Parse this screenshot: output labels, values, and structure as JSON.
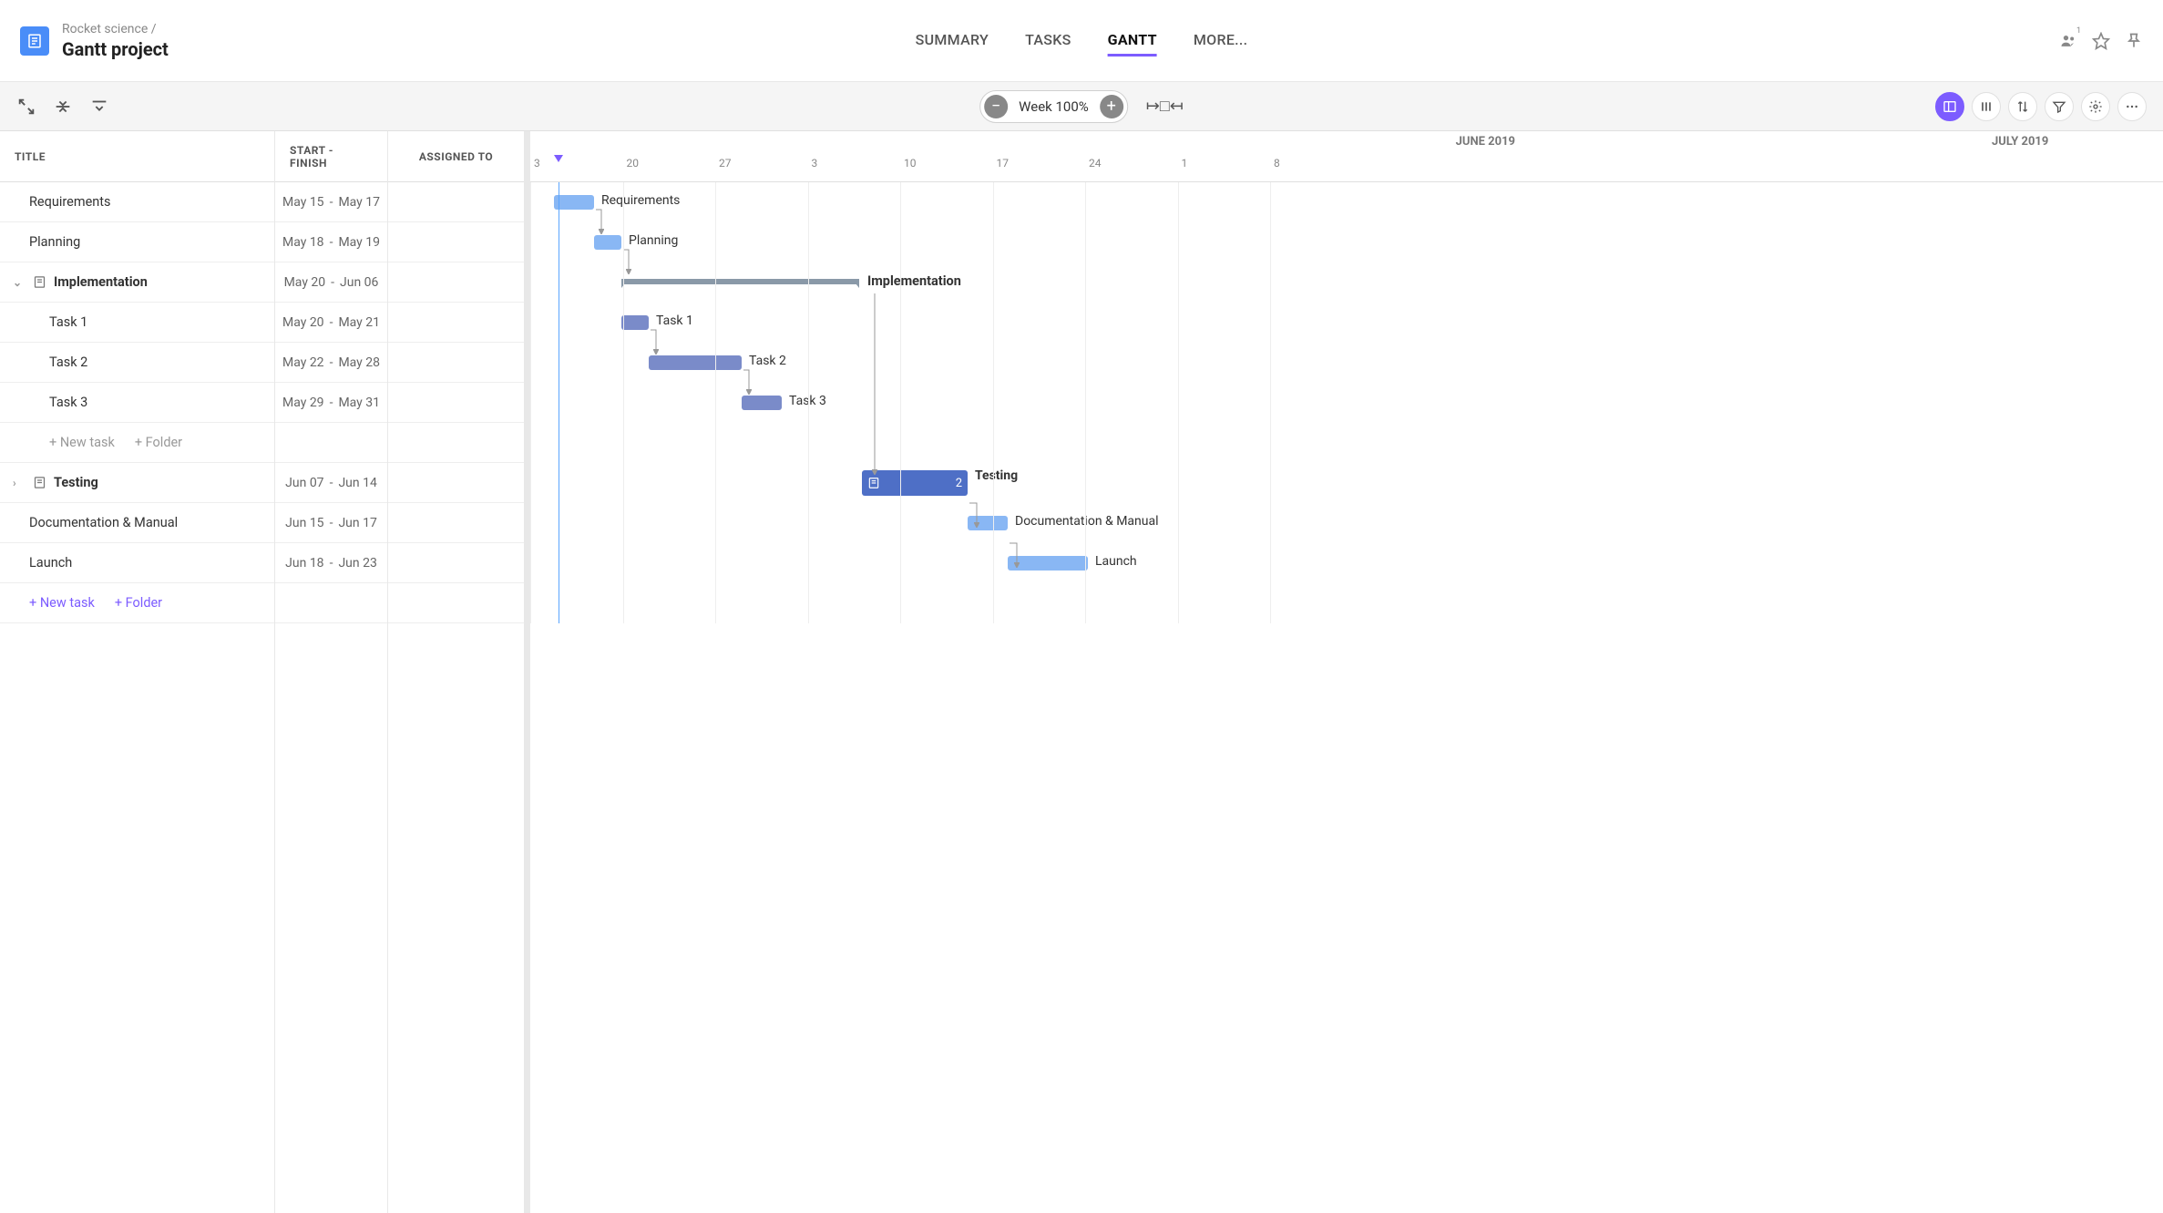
{
  "breadcrumb": "Rocket science  /",
  "project_title": "Gantt project",
  "member_count": "1",
  "tabs": {
    "summary": "SUMMARY",
    "tasks": "TASKS",
    "gantt": "GANTT",
    "more": "MORE..."
  },
  "toolbar": {
    "zoom_label": "Week 100%"
  },
  "grid": {
    "headers": {
      "title": "TITLE",
      "dates": "START - FINISH",
      "assigned": "ASSIGNED TO"
    },
    "new_task": "+ New task",
    "new_folder": "+ Folder"
  },
  "timeline": {
    "months": {
      "june": "JUNE 2019",
      "july": "JULY 2019"
    },
    "days": [
      "3",
      "20",
      "27",
      "3",
      "10",
      "17",
      "24",
      "1",
      "8"
    ]
  },
  "tasks": [
    {
      "id": "req",
      "title": "Requirements",
      "start": "May 15",
      "finish": "May 17"
    },
    {
      "id": "plan",
      "title": "Planning",
      "start": "May 18",
      "finish": "May 19"
    },
    {
      "id": "impl",
      "title": "Implementation",
      "start": "May 20",
      "finish": "Jun 06"
    },
    {
      "id": "t1",
      "title": "Task 1",
      "start": "May 20",
      "finish": "May 21"
    },
    {
      "id": "t2",
      "title": "Task 2",
      "start": "May 22",
      "finish": "May 28"
    },
    {
      "id": "t3",
      "title": "Task 3",
      "start": "May 29",
      "finish": "May 31"
    },
    {
      "id": "test",
      "title": "Testing",
      "start": "Jun 07",
      "finish": "Jun 14",
      "subcount": "2"
    },
    {
      "id": "doc",
      "title": "Documentation & Manual",
      "start": "Jun 15",
      "finish": "Jun 17"
    },
    {
      "id": "launch",
      "title": "Launch",
      "start": "Jun 18",
      "finish": "Jun 23"
    }
  ],
  "chart_data": {
    "type": "gantt",
    "title": "Gantt project",
    "time_axis": {
      "unit": "day",
      "visible_start": "2019-05-13",
      "visible_end": "2019-07-14",
      "today": "2019-05-15"
    },
    "tasks": [
      {
        "id": "req",
        "name": "Requirements",
        "start": "2019-05-15",
        "end": "2019-05-17",
        "type": "task",
        "depends_on": []
      },
      {
        "id": "plan",
        "name": "Planning",
        "start": "2019-05-18",
        "end": "2019-05-19",
        "type": "task",
        "depends_on": [
          "req"
        ]
      },
      {
        "id": "impl",
        "name": "Implementation",
        "start": "2019-05-20",
        "end": "2019-06-06",
        "type": "summary",
        "depends_on": [
          "plan"
        ],
        "children": [
          "t1",
          "t2",
          "t3"
        ]
      },
      {
        "id": "t1",
        "name": "Task 1",
        "start": "2019-05-20",
        "end": "2019-05-21",
        "type": "task",
        "parent": "impl",
        "depends_on": [
          "plan"
        ]
      },
      {
        "id": "t2",
        "name": "Task 2",
        "start": "2019-05-22",
        "end": "2019-05-28",
        "type": "task",
        "parent": "impl",
        "depends_on": [
          "t1"
        ]
      },
      {
        "id": "t3",
        "name": "Task 3",
        "start": "2019-05-29",
        "end": "2019-05-31",
        "type": "task",
        "parent": "impl",
        "depends_on": [
          "t2"
        ]
      },
      {
        "id": "test",
        "name": "Testing",
        "start": "2019-06-07",
        "end": "2019-06-14",
        "type": "summary",
        "depends_on": [
          "impl"
        ],
        "subtask_count": 2
      },
      {
        "id": "doc",
        "name": "Documentation & Manual",
        "start": "2019-06-15",
        "end": "2019-06-17",
        "type": "task",
        "depends_on": [
          "test"
        ]
      },
      {
        "id": "launch",
        "name": "Launch",
        "start": "2019-06-18",
        "end": "2019-06-23",
        "type": "task",
        "depends_on": [
          "doc"
        ]
      }
    ]
  }
}
